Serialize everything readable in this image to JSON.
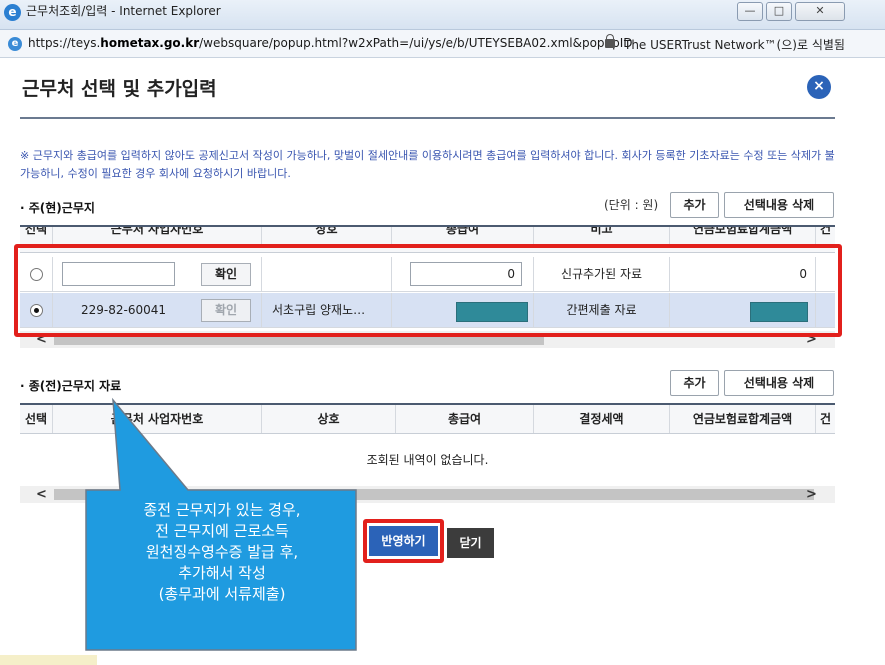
{
  "window": {
    "title": "근무처조회/입력 - Internet Explorer",
    "url_prefix": "https://teys.",
    "url_host": "hometax.go.kr",
    "url_rest": "/websquare/popup.html?w2xPath=/ui/ys/e/b/UTEYSEBA02.xml&popupID",
    "certificate": "The USERTrust Network™(으)로 식별됨",
    "minimize_glyph": "—",
    "maximize_glyph": "□",
    "close_glyph": "✕"
  },
  "popup": {
    "title": "근무처 선택 및 추가입력",
    "close_glyph": "×",
    "notice": "※ 근무지와 총급여를 입력하지 않아도 공제신고서 작성이 가능하나, 맞벌이 절세안내를 이용하시려면 총급여를 입력하셔야 합니다. 회사가 등록한 기초자료는 수정 또는 삭제가 불가능하니, 수정이 필요한 경우 회사에 요청하시기 바랍니다."
  },
  "current_section": {
    "title": "· 주(현)근무지",
    "unit": "(단위 : 원)",
    "add_label": "추가",
    "delete_label": "선택내용 삭제",
    "columns": [
      "선택",
      "근무처 사업자번호",
      "상호",
      "총급여",
      "비고",
      "연금보험료합계금액",
      "건"
    ],
    "rows": [
      {
        "selected": false,
        "bizno": "",
        "confirm": "확인",
        "name": "",
        "salary": "0",
        "note": "신규추가된 자료",
        "pension": "0",
        "masked": false
      },
      {
        "selected": true,
        "bizno": "229-82-60041",
        "confirm": "확인",
        "name": "서초구립 양재노…",
        "salary": "",
        "note": "간편제출 자료",
        "pension": "",
        "masked": true
      }
    ]
  },
  "previous_section": {
    "title": "· 종(전)근무지 자료",
    "add_label": "추가",
    "delete_label": "선택내용 삭제",
    "columns": [
      "선택",
      "근무처 사업자번호",
      "상호",
      "총급여",
      "결정세액",
      "연금보험료합계금액",
      "건"
    ],
    "empty_message": "조회된 내역이 없습니다."
  },
  "scroll": {
    "left_glyph": "<",
    "right_glyph": ">"
  },
  "actions": {
    "apply_label": "반영하기",
    "close_label": "닫기"
  },
  "callout": {
    "lines": [
      "종전 근무지가 있는 경우,",
      "전 근무지에 근로소득",
      "원천징수영수증 발급 후,",
      "추가해서 작성",
      "(총무과에 서류제출)"
    ]
  },
  "colors": {
    "accent_blue": "#2b63b8",
    "highlight_red": "#e2201c",
    "callout_blue": "#1f9be0",
    "masked_teal": "#2f8a99"
  }
}
